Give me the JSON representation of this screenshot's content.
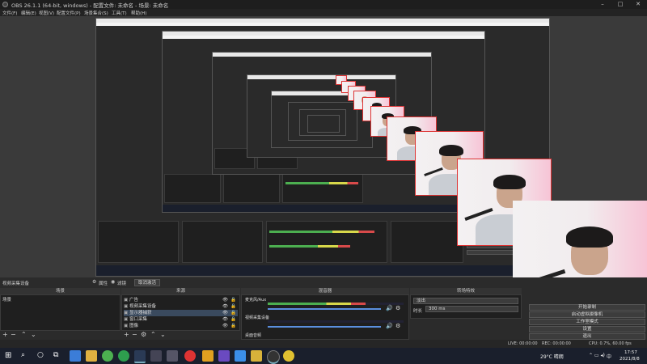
{
  "window": {
    "title": "OBS 26.1.1 (64-bit, windows) - 配置文件: 未命名 - 场景: 未命名"
  },
  "menu": [
    "文件(F)",
    "编辑(E)",
    "视图(V)",
    "配置文件(P)",
    "场景集合(S)",
    "工具(T)",
    "帮助(H)"
  ],
  "toolbar": {
    "source_name": "视频采集设备",
    "properties": "属性",
    "filters": "滤镜",
    "deactivate": "取消激活"
  },
  "scenes": {
    "header": "场景",
    "items": [
      "场景"
    ]
  },
  "sources": {
    "header": "来源",
    "items": [
      {
        "label": "广告",
        "selected": false
      },
      {
        "label": "视频采集设备",
        "selected": false
      },
      {
        "label": "显示器捕获",
        "selected": true
      },
      {
        "label": "窗口采集",
        "selected": false
      },
      {
        "label": "图像",
        "selected": false
      }
    ]
  },
  "mixer": {
    "header": "混音器",
    "channels": [
      {
        "name": "麦克风/Aux",
        "level": 0.72,
        "volume": 0.85
      },
      {
        "name": "视频采集设备",
        "level": 0.0,
        "volume": 0.85
      },
      {
        "name": "桌面音频",
        "level": 0.0,
        "volume": 0.85
      }
    ]
  },
  "transitions": {
    "header": "转场特效",
    "type": "淡出",
    "duration_label": "时长",
    "duration_value": "300 ms"
  },
  "controls": {
    "buttons": [
      "开始录制",
      "启动虚拟摄像机",
      "工作室模式",
      "设置",
      "退出"
    ]
  },
  "status": {
    "live": "LIVE: 00:00:00",
    "rec": "REC: 00:00:00",
    "cpu": "CPU: 0.7%, 60.00 fps"
  },
  "taskbar": {
    "weather": "29°C 晴朗",
    "time": "17:57",
    "date": "2021/8/8",
    "lang": "中"
  },
  "colors": {
    "accent": "#5a8fe0",
    "selection": "#3a4a5e",
    "border_red": "#dd3333"
  }
}
